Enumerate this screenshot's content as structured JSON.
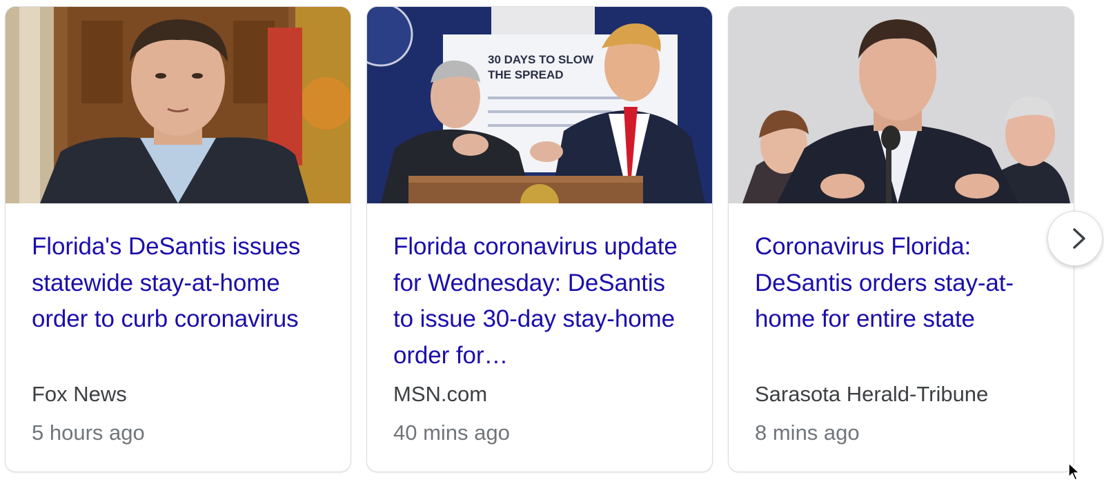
{
  "cards": [
    {
      "image_alt": "Ron DeSantis portrait",
      "headline": "Florida's DeSantis issues statewide stay-at-home order to curb coronavirus",
      "source": "Fox News",
      "age": "5 hours ago"
    },
    {
      "image_alt": "Press briefing at podium",
      "image_sign_line1": "30 DAYS TO SLOW",
      "image_sign_line2": "THE SPREAD",
      "headline": "Florida coronavirus update for Wednesday: DeSantis to issue 30-day stay-home order for…",
      "source": "MSN.com",
      "age": "40 mins ago"
    },
    {
      "image_alt": "DeSantis speaking at microphone",
      "headline": "Coronavirus Florida: DeSantis orders stay-at-home for entire state",
      "source": "Sarasota Herald-Tribune",
      "age": "8 mins ago"
    }
  ],
  "next_button": {
    "icon": "chevron-right-icon"
  },
  "colors": {
    "headline": "#1a0dab",
    "source": "#3c4043",
    "age": "#70757a",
    "border": "#dadce0"
  }
}
